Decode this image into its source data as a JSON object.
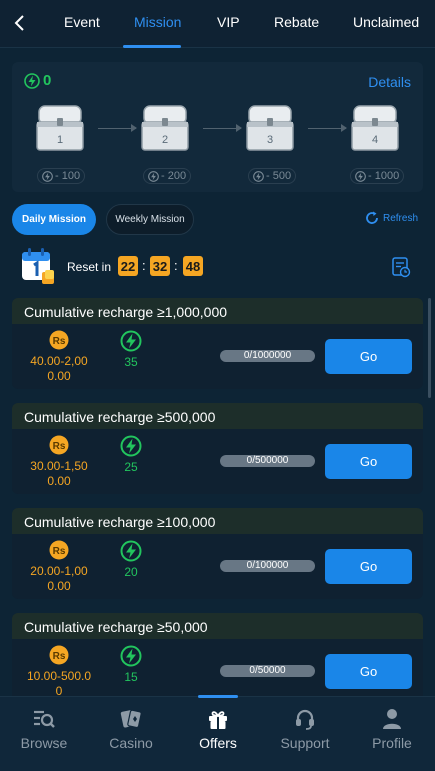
{
  "tabs": [
    {
      "label": "Event",
      "active": false
    },
    {
      "label": "Mission",
      "active": true
    },
    {
      "label": "VIP",
      "active": false
    },
    {
      "label": "Rebate",
      "active": false
    },
    {
      "label": "Unclaimed",
      "active": false
    }
  ],
  "energy": {
    "total": "0",
    "details_label": "Details"
  },
  "chests": [
    {
      "number": "1",
      "cost": "- 100"
    },
    {
      "number": "2",
      "cost": "- 200"
    },
    {
      "number": "3",
      "cost": "- 500"
    },
    {
      "number": "4",
      "cost": "- 1000"
    }
  ],
  "mission_tabs": {
    "daily": "Daily Mission",
    "weekly": "Weekly Mission",
    "active": "daily"
  },
  "refresh_label": "Refresh",
  "reset": {
    "label": "Reset in",
    "hours": "22",
    "minutes": "32",
    "seconds": "48"
  },
  "missions": [
    {
      "title": "Cumulative recharge ≥1,000,000",
      "reward_line1": "40.00-2,00",
      "reward_line2": "0.00",
      "energy": "35",
      "progress": "0/1000000",
      "go_label": "Go"
    },
    {
      "title": "Cumulative recharge ≥500,000",
      "reward_line1": "30.00-1,50",
      "reward_line2": "0.00",
      "energy": "25",
      "progress": "0/500000",
      "go_label": "Go"
    },
    {
      "title": "Cumulative recharge ≥100,000",
      "reward_line1": "20.00-1,00",
      "reward_line2": "0.00",
      "energy": "20",
      "progress": "0/100000",
      "go_label": "Go"
    },
    {
      "title": "Cumulative recharge ≥50,000",
      "reward_line1": "10.00-500.0",
      "reward_line2": "0",
      "energy": "15",
      "progress": "0/50000",
      "go_label": "Go"
    }
  ],
  "currency_icon_text": "Rs",
  "bottom_nav": [
    {
      "label": "Browse",
      "icon": "browse-icon",
      "active": false
    },
    {
      "label": "Casino",
      "icon": "cards-icon",
      "active": false
    },
    {
      "label": "Offers",
      "icon": "gift-icon",
      "active": true
    },
    {
      "label": "Support",
      "icon": "headset-icon",
      "active": false
    },
    {
      "label": "Profile",
      "icon": "user-icon",
      "active": false
    }
  ],
  "colors": {
    "accent": "#2f8ff0",
    "energy_green": "#22c55e",
    "reward_orange": "#f5a623",
    "background": "#0d2435"
  }
}
